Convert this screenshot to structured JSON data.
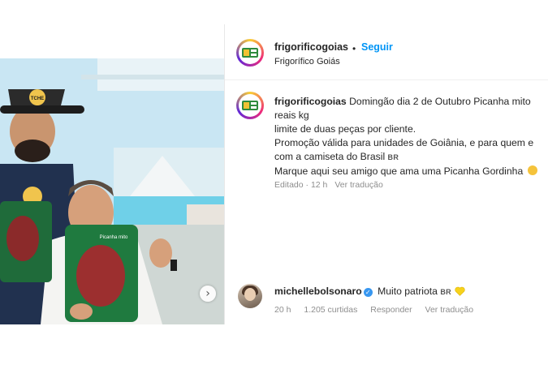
{
  "post": {
    "author_handle": "frigorificogoias",
    "follow_label": "Seguir",
    "separator": "•",
    "author_name": "Frigorífico Goiás"
  },
  "caption": {
    "handle": "frigorificogoias",
    "line1": "Domingão dia 2 de Outubro Picanha mito",
    "line2": "reais kg",
    "line3": "limite de duas peças por cliente.",
    "line4": "Promoção válida para unidades de Goiânia, e para quem e",
    "line5": "com a camiseta do Brasil",
    "line5_flag": "BR",
    "line6": "Marque aqui seu amigo que ama uma Picanha Gordinha",
    "time": "Editado · 12 h",
    "translate": "Ver tradução"
  },
  "comment": {
    "handle": "michellebolsonaro",
    "text": "Muito patriota",
    "flag": "BR",
    "time": "20 h",
    "likes": "1.205 curtidas",
    "reply": "Responder",
    "translate": "Ver tradução"
  },
  "photo": {
    "hat_text": "TCHE",
    "package_text": "Picanha mito"
  },
  "colors": {
    "follow": "#0095f6",
    "verified": "#3897f0",
    "meta": "#8e8e8e"
  },
  "icons": {
    "carousel_next": "chevron-right-icon",
    "verified": "verified-badge-icon",
    "heart": "yellow-heart-icon"
  }
}
